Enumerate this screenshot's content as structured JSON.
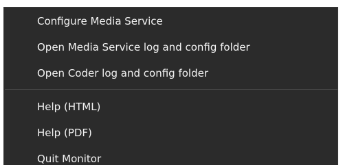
{
  "menu": {
    "items": [
      {
        "label": "Configure Media Service"
      },
      {
        "label": "Open Media Service log and config folder"
      },
      {
        "label": "Open Coder log and config folder"
      },
      {
        "label": "Help (HTML)"
      },
      {
        "label": "Help (PDF)"
      },
      {
        "label": "Quit Monitor"
      }
    ]
  },
  "colors": {
    "menu_background": "#2b2b2b",
    "text": "#f2f2f2",
    "separator": "#4a4a4a"
  }
}
